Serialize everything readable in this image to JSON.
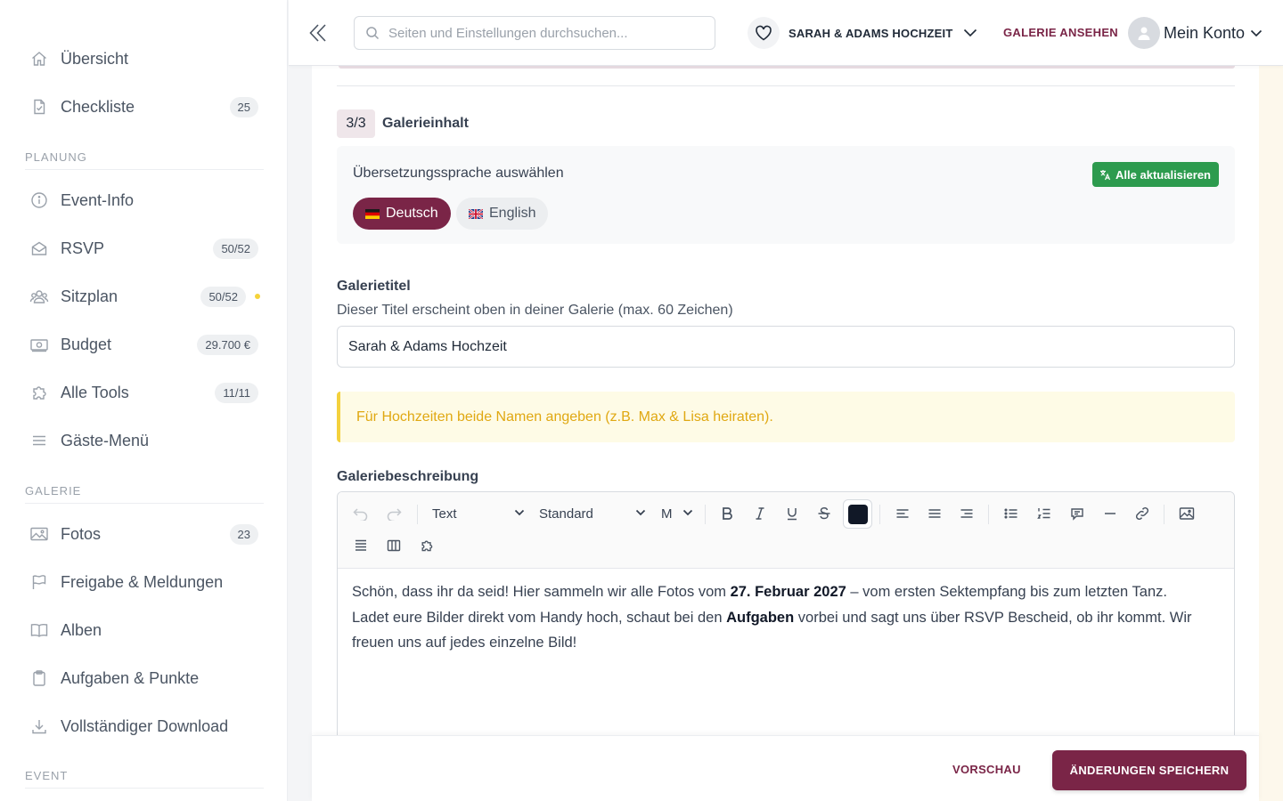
{
  "sidebar": {
    "items": [
      {
        "label": "Übersicht",
        "icon": "home-icon"
      },
      {
        "label": "Checkliste",
        "icon": "checklist-icon",
        "badge": "25"
      }
    ],
    "sections": [
      {
        "title": "PLANUNG",
        "items": [
          {
            "label": "Event-Info",
            "icon": "info-icon"
          },
          {
            "label": "RSVP",
            "icon": "envelope-open-icon",
            "badge": "50/52"
          },
          {
            "label": "Sitzplan",
            "icon": "users-icon",
            "badge": "50/52"
          },
          {
            "label": "Budget",
            "icon": "money-icon",
            "badge": "29.700 €"
          },
          {
            "label": "Alle Tools",
            "icon": "puzzle-icon",
            "badge": "11/11"
          },
          {
            "label": "Gäste-Menü",
            "icon": "menu-icon"
          }
        ]
      },
      {
        "title": "GALERIE",
        "items": [
          {
            "label": "Fotos",
            "icon": "image-icon",
            "badge": "23"
          },
          {
            "label": "Freigabe & Meldungen",
            "icon": "flag-icon"
          },
          {
            "label": "Alben",
            "icon": "book-icon"
          },
          {
            "label": "Aufgaben & Punkte",
            "icon": "clipboard-icon"
          },
          {
            "label": "Vollständiger Download",
            "icon": "download-icon"
          }
        ]
      },
      {
        "title": "EVENT",
        "items": []
      }
    ]
  },
  "topbar": {
    "search_placeholder": "Seiten und Einstellungen durchsuchen...",
    "event_name": "SARAH & ADAMS HOCHZEIT",
    "view_gallery": "GALERIE ANSEHEN",
    "account": "Mein Konto"
  },
  "step": {
    "badge": "3/3",
    "title": "Galerieinhalt"
  },
  "translation": {
    "label": "Übersetzungssprache auswählen",
    "update_all": "Alle aktualisieren",
    "languages": [
      {
        "label": "Deutsch",
        "active": true
      },
      {
        "label": "English",
        "active": false
      }
    ]
  },
  "gallery_title": {
    "label": "Galerietitel",
    "help": "Dieser Titel erscheint oben in deiner Galerie (max. 60 Zeichen)",
    "value": "Sarah & Adams Hochzeit"
  },
  "warning": "Für Hochzeiten beide Namen angeben (z.B. Max & Lisa heiraten).",
  "description": {
    "label": "Galeriebeschreibung",
    "toolbar": {
      "block_type": "Text",
      "font": "Standard",
      "size": "M",
      "text_color": "#111827"
    },
    "segments": [
      {
        "text": "Schön, dass ihr da seid! Hier sammeln wir alle Fotos vom ",
        "bold": false
      },
      {
        "text": "27. Februar 2027",
        "bold": true
      },
      {
        "text": " – vom ersten Sektempfang bis zum letzten Tanz. Ladet eure Bilder direkt vom Handy hoch, schaut bei den ",
        "bold": false
      },
      {
        "text": "Aufgaben",
        "bold": true
      },
      {
        "text": " vorbei und sagt uns über RSVP Bescheid, ob ihr kommt. Wir freuen uns auf jedes einzelne Bild!",
        "bold": false
      }
    ]
  },
  "footer": {
    "preview": "VORSCHAU",
    "save": "ÄNDERUNGEN SPEICHERN"
  },
  "colors": {
    "brand": "#7a2547",
    "success": "#2d9b4e",
    "warning_text": "#e0a812",
    "warning_bg": "#fefbe6"
  }
}
